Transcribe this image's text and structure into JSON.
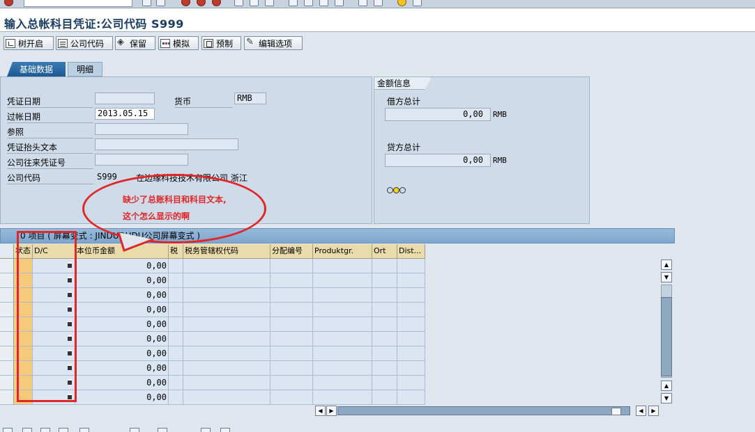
{
  "window": {
    "title": "输入总帐科目凭证:公司代码 S999"
  },
  "toolbar": {
    "tree_on": "树开启",
    "company_code": "公司代码",
    "hold": "保留",
    "simulate": "模拟",
    "park": "预制",
    "edit_options": "编辑选项"
  },
  "tabs": {
    "basic_data": "基础数据",
    "details": "明细"
  },
  "header": {
    "doc_date_label": "凭证日期",
    "doc_date_value": "",
    "currency_label": "货币",
    "currency_value": "RMB",
    "posting_date_label": "过帐日期",
    "posting_date_value": "2013.05.15",
    "reference_label": "参照",
    "reference_value": "",
    "header_text_label": "凭证抬头文本",
    "header_text_value": "",
    "intercompany_label": "公司往来凭证号",
    "intercompany_value": "",
    "company_code_label": "公司代码",
    "company_code_value": "S999",
    "company_name": "在边缘科技技术有限公司 浙江"
  },
  "amount_info": {
    "title": "金额信息",
    "debit_label": "借方总计",
    "debit_value": "0,00",
    "debit_currency": "RMB",
    "credit_label": "贷方总计",
    "credit_value": "0,00",
    "credit_currency": "RMB"
  },
  "table": {
    "title": "0 项目 ( 屏幕变式 : JINDUDUDU公司屏幕变式 )",
    "columns": [
      "状态",
      "D/C",
      "本位币金额",
      "税",
      "税务管辖权代码",
      "分配编号",
      "Produktgr.",
      "Ort",
      "Dist..."
    ],
    "rows": [
      {
        "amount": "0,00"
      },
      {
        "amount": "0,00"
      },
      {
        "amount": "0,00"
      },
      {
        "amount": "0,00"
      },
      {
        "amount": "0,00"
      },
      {
        "amount": "0,00"
      },
      {
        "amount": "0,00"
      },
      {
        "amount": "0,00"
      },
      {
        "amount": "0,00"
      },
      {
        "amount": "0,00"
      }
    ]
  },
  "annotation": {
    "text": "缺少了总账科目和科目文本,这个怎么显示的啊",
    "color": "#e02626"
  }
}
